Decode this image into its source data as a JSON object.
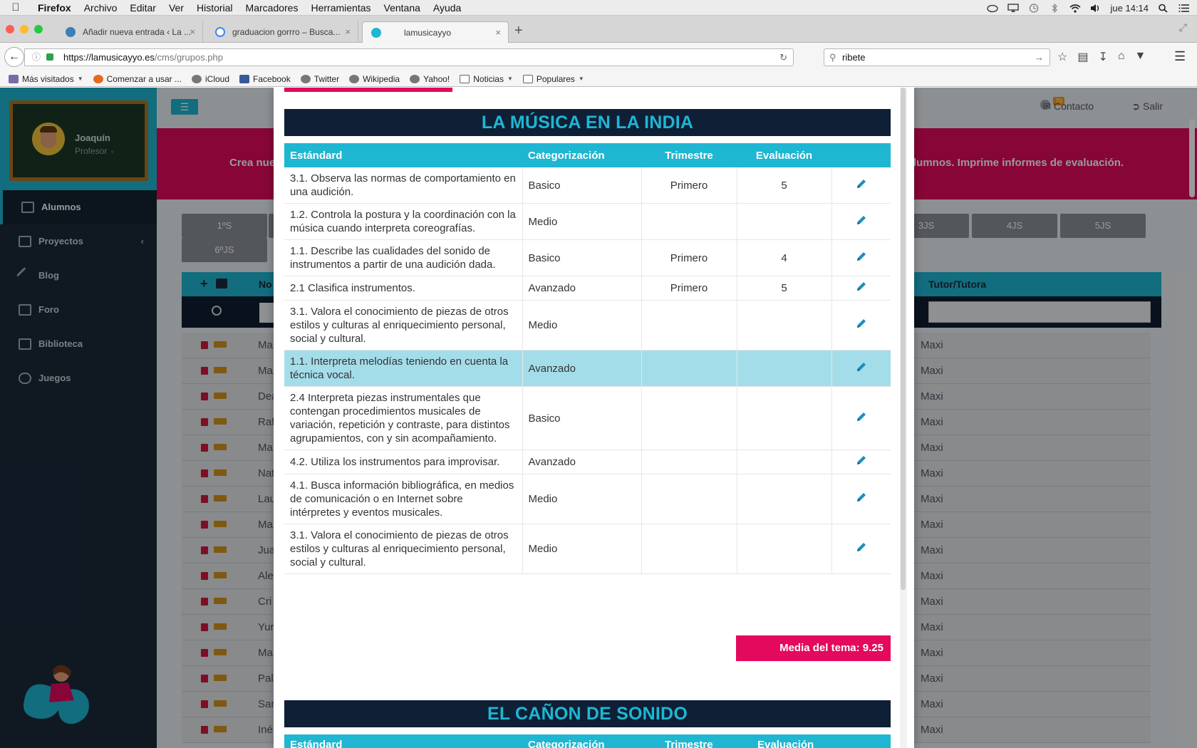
{
  "os_menu": {
    "app": "Firefox",
    "items": [
      "Archivo",
      "Editar",
      "Ver",
      "Historial",
      "Marcadores",
      "Herramientas",
      "Ventana",
      "Ayuda"
    ],
    "clock": "jue 14:14"
  },
  "browser": {
    "tabs": [
      {
        "title": "Añadir nueva entrada ‹ La ...",
        "close": "×"
      },
      {
        "title": "graduacion gorrro – Busca...",
        "close": "×"
      },
      {
        "title": "lamusicayyo",
        "close": "×"
      }
    ],
    "new_tab": "+",
    "url_host": "https://lamusicayyo.es",
    "url_path": "/cms/grupos.php",
    "search_value": "ribete",
    "bookmarks": [
      "Más visitados",
      "Comenzar a usar ...",
      "iCloud",
      "Facebook",
      "Twitter",
      "Wikipedia",
      "Yahoo!",
      "Noticias",
      "Populares"
    ]
  },
  "sidebar": {
    "user_name": "Joaquín",
    "user_role": "Profesor",
    "items": [
      {
        "label": "Alumnos"
      },
      {
        "label": "Proyectos"
      },
      {
        "label": "Blog"
      },
      {
        "label": "Foro"
      },
      {
        "label": "Biblioteca"
      },
      {
        "label": "Juegos"
      }
    ]
  },
  "topbar": {
    "notification_count": "70",
    "contact": "Contacto",
    "logout": "Salir"
  },
  "banner": {
    "left_text": "Crea nue",
    "right_text": "lumnos. Imprime informes de evaluación."
  },
  "groups": {
    "buttons": [
      "1ºS",
      "6ºJS",
      "3JS",
      "4JS",
      "5JS"
    ]
  },
  "students_table": {
    "col_name": "No",
    "col_tutor": "Tutor/Tutora",
    "rows": [
      {
        "name": "Ma",
        "tutor": "Maxi"
      },
      {
        "name": "Ma",
        "tutor": "Maxi"
      },
      {
        "name": "Dea",
        "tutor": "Maxi"
      },
      {
        "name": "Raf",
        "tutor": "Maxi"
      },
      {
        "name": "Ma",
        "tutor": "Maxi"
      },
      {
        "name": "Nat",
        "tutor": "Maxi"
      },
      {
        "name": "Lau",
        "tutor": "Maxi"
      },
      {
        "name": "Ma",
        "tutor": "Maxi"
      },
      {
        "name": "Jua",
        "tutor": "Maxi"
      },
      {
        "name": "Ale",
        "tutor": "Maxi"
      },
      {
        "name": "Cri",
        "tutor": "Maxi"
      },
      {
        "name": "Yur",
        "tutor": "Maxi"
      },
      {
        "name": "Ma",
        "tutor": "Maxi"
      },
      {
        "name": "Pal",
        "tutor": "Maxi"
      },
      {
        "name": "San",
        "tutor": "Maxi"
      },
      {
        "name": "Iné",
        "tutor": "Maxi"
      }
    ]
  },
  "modal": {
    "section1_title": "LA MÚSICA EN LA INDIA",
    "headers": [
      "Estándard",
      "Categorización",
      "Trimestre",
      "Evaluación"
    ],
    "rows": [
      {
        "standard": "3.1. Observa las normas de comportamiento en una audición.",
        "category": "Basico",
        "term": "Primero",
        "grade": "5"
      },
      {
        "standard": "1.2. Controla la postura y la coordinación con la música cuando interpreta coreografías.",
        "category": "Medio",
        "term": "",
        "grade": ""
      },
      {
        "standard": "1.1. Describe las cualidades del sonido de instrumentos a partir de una audición dada.",
        "category": "Basico",
        "term": "Primero",
        "grade": "4"
      },
      {
        "standard": "2.1 Clasifica instrumentos.",
        "category": "Avanzado",
        "term": "Primero",
        "grade": "5"
      },
      {
        "standard": "3.1. Valora el conocimiento de piezas de otros estilos y culturas al enriquecimiento personal, social y cultural.",
        "category": "Medio",
        "term": "",
        "grade": ""
      },
      {
        "standard": "1.1. Interpreta melodías teniendo en cuenta la técnica vocal.",
        "category": "Avanzado",
        "term": "",
        "grade": ""
      },
      {
        "standard": "2.4 Interpreta piezas instrumentales que contengan procedimientos musicales de variación, repetición y contraste, para distintos agrupamientos, con y sin acompañamiento.",
        "category": "Basico",
        "term": "",
        "grade": ""
      },
      {
        "standard": "4.2. Utiliza los instrumentos para improvisar.",
        "category": "Avanzado",
        "term": "",
        "grade": ""
      },
      {
        "standard": "4.1. Busca información bibliográfica, en medios de comunicación o en Internet sobre intérpretes y eventos musicales.",
        "category": "Medio",
        "term": "",
        "grade": ""
      },
      {
        "standard": "3.1. Valora el conocimiento de piezas de otros estilos y culturas al enriquecimiento personal, social y cultural.",
        "category": "Medio",
        "term": "",
        "grade": ""
      }
    ],
    "average": "Media del tema: 9.25",
    "section2_title": "EL CAÑON DE SONIDO",
    "section2_headers": [
      "Estándard",
      "Categorización",
      "Trimestre",
      "Evaluación"
    ]
  },
  "colors": {
    "accent": "#1fb6d2",
    "brand_pink": "#e3095c",
    "navy": "#0e1f36",
    "highlight_row": "#a4ddea"
  }
}
